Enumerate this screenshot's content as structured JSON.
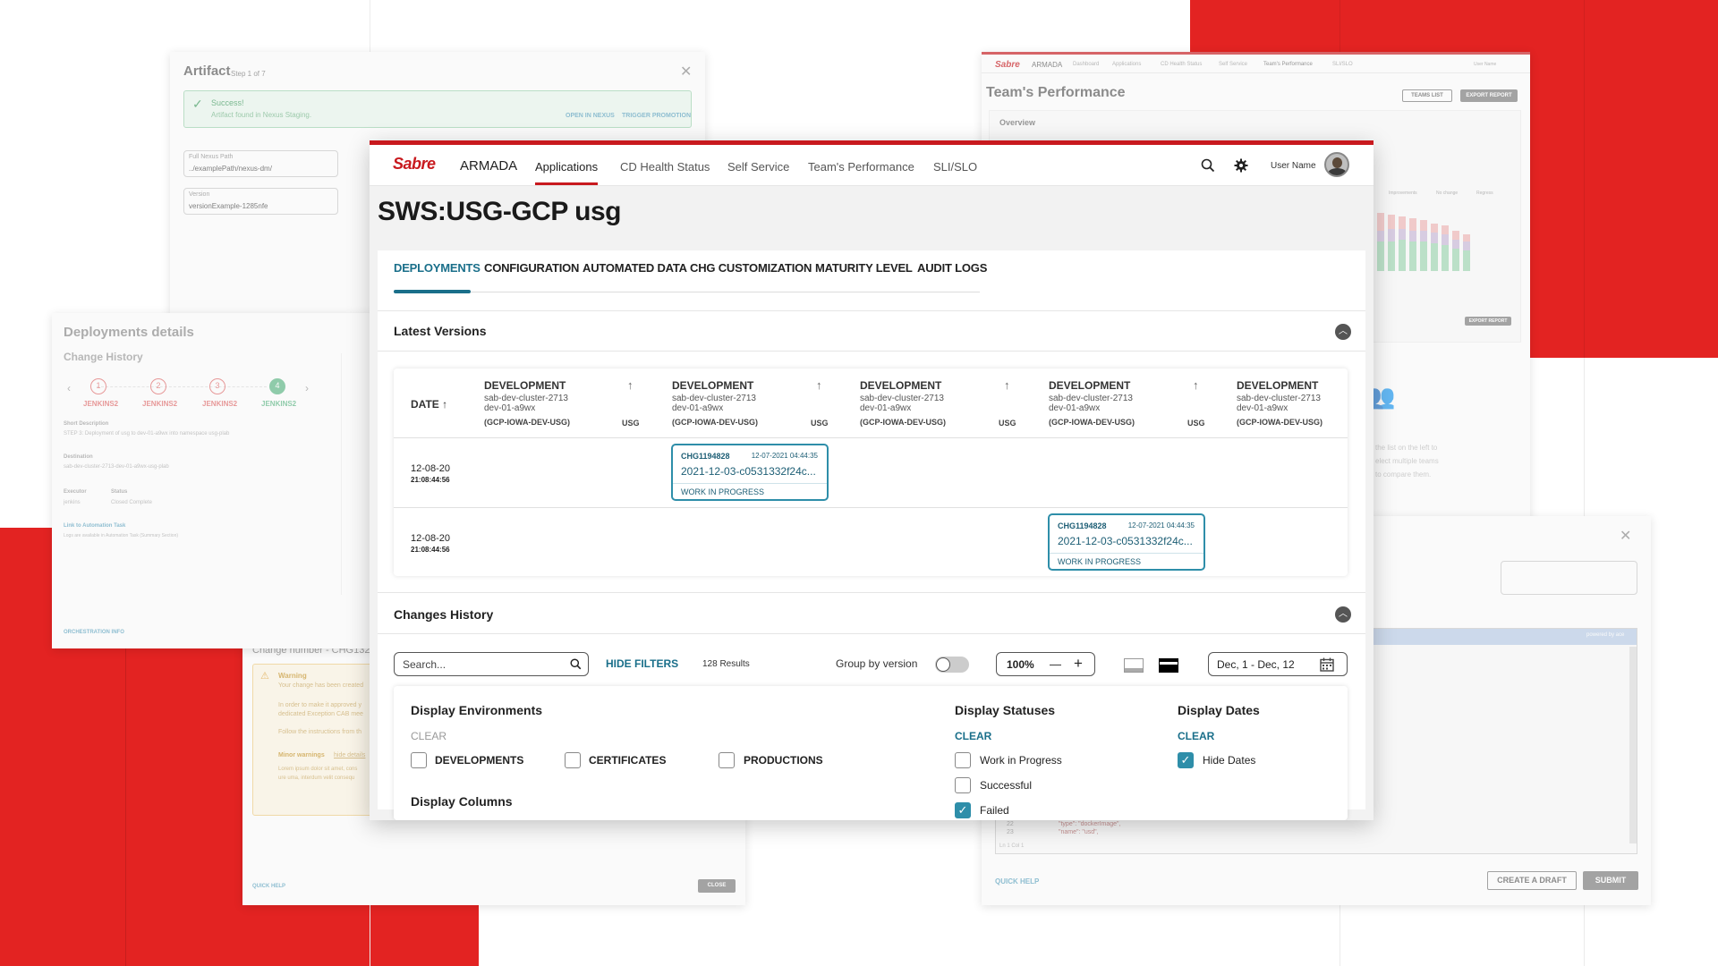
{
  "colors": {
    "brand_red": "#e32322",
    "accent_teal": "#1a6f8a",
    "chg_border": "#2e8ea9"
  },
  "ghost_artifact": {
    "title": "Artifact",
    "step": "Step 1 of 7",
    "success_title": "Success!",
    "success_text": "Artifact found in Nexus Staging.",
    "open_link": "OPEN IN NEXUS",
    "trigger_link": "TRIGGER PROMOTION",
    "path_label": "Full Nexus Path",
    "path_value": "../examplePath/nexus-dm/",
    "version_label": "Version",
    "version_value": "versionExample-1285nfe"
  },
  "ghost_deployments": {
    "title": "Deployments details",
    "subtitle": "Change History",
    "steps": [
      {
        "n": "1",
        "label": "JENKINS2"
      },
      {
        "n": "2",
        "label": "JENKINS2"
      },
      {
        "n": "3",
        "label": "JENKINS2"
      },
      {
        "n": "4",
        "label": "JENKINS2"
      }
    ],
    "short_desc_label": "Short Description",
    "short_desc": "STEP 3: Deployment of usg to dev-01-a9wx into namespace usg-plab",
    "dest_label": "Destination",
    "dest": "sab-dev-cluster-2713-dev-01-a9wx-usg-plab",
    "executor_label": "Executor",
    "executor": "jenkins",
    "status_label": "Status",
    "status": "Closed Complete",
    "link": "Link to Automation Task",
    "link_note": "Logs are available in Automation Task (Summary Section)",
    "orch": "ORCHESTRATION INFO"
  },
  "ghost_change": {
    "change_number": "Change number - CHG132",
    "warning": "Warning",
    "w1": "Your change has been created",
    "w2": "In order to make it approved y",
    "w3": "dedicated Exception CAB mee",
    "w4": "Follow the instructions from th",
    "minor": "Minor warnings",
    "hide": "hide details",
    "lorem1": "Lorem ipsum dolor sit amet, cons",
    "lorem2": "ure uma, interdum velit consequ",
    "quick_help": "QUICK HELP",
    "close": "CLOSE"
  },
  "ghost_perf": {
    "brand": "Sabre",
    "app": "ARMADA",
    "nav": [
      "Dashboard",
      "Applications",
      "CD Health Status",
      "Self Service",
      "Team's Performance",
      "SLI/SLO"
    ],
    "user": "User Name",
    "title": "Team's Performance",
    "teams_list": "TEAMS LIST",
    "export": "EXPORT REPORT",
    "overview": "Overview",
    "legend": [
      "Improvements",
      "No change",
      "Regress"
    ],
    "export2": "EXPORT REPORT",
    "hint1": "the list on the left to",
    "hint2": "elect multiple teams",
    "hint3": "to compare them."
  },
  "ghost_submit": {
    "powered": "powered by ace",
    "code1": "\"type\": \"dockerImage\",",
    "code2": "\"name\": \"usd\",",
    "ln": "Ln 1 Col 1",
    "quick_help": "QUICK HELP",
    "draft": "CREATE A DRAFT",
    "submit": "SUBMIT"
  },
  "header": {
    "brand": "Sabre",
    "app_name": "ARMADA",
    "nav": [
      "Applications",
      "CD Health Status",
      "Self Service",
      "Team's Performance",
      "SLI/SLO"
    ],
    "user_name": "User Name"
  },
  "page_title": "SWS:USG-GCP usg",
  "tabs": [
    "DEPLOYMENTS",
    "CONFIGURATION",
    "AUTOMATED DATA",
    "CHG CUSTOMIZATION",
    "MATURITY LEVEL",
    "AUDIT LOGS"
  ],
  "latest": {
    "title": "Latest Versions",
    "date_header": "DATE",
    "columns": [
      {
        "env": "DEVELOPMENT",
        "cluster": "sab-dev-cluster-2713",
        "ns": "dev-01-a9wx",
        "region": "(GCP-IOWA-DEV-USG)",
        "app": "USG"
      },
      {
        "env": "DEVELOPMENT",
        "cluster": "sab-dev-cluster-2713",
        "ns": "dev-01-a9wx",
        "region": "(GCP-IOWA-DEV-USG)",
        "app": "USG"
      },
      {
        "env": "DEVELOPMENT",
        "cluster": "sab-dev-cluster-2713",
        "ns": "dev-01-a9wx",
        "region": "(GCP-IOWA-DEV-USG)",
        "app": "USG"
      },
      {
        "env": "DEVELOPMENT",
        "cluster": "sab-dev-cluster-2713",
        "ns": "dev-01-a9wx",
        "region": "(GCP-IOWA-DEV-USG)",
        "app": "USG"
      },
      {
        "env": "DEVELOPMENT",
        "cluster": "sab-dev-cluster-2713",
        "ns": "dev-01-a9wx",
        "region": "(GCP-IOWA-DEV-USG)"
      }
    ],
    "rows": [
      {
        "date": "12-08-20",
        "time": "21:08:44:56",
        "card": {
          "id": "CHG1194828",
          "ts": "12-07-2021 04:44:35",
          "version": "2021-12-03-c0531332f24c...",
          "status": "WORK IN PROGRESS"
        }
      },
      {
        "date": "12-08-20",
        "time": "21:08:44:56",
        "card": {
          "id": "CHG1194828",
          "ts": "12-07-2021 04:44:35",
          "version": "2021-12-03-c0531332f24c...",
          "status": "WORK IN PROGRESS"
        }
      }
    ]
  },
  "history": {
    "title": "Changes History",
    "search_placeholder": "Search...",
    "hide_filters": "HIDE FILTERS",
    "results": "128 Results",
    "group_by": "Group by version",
    "zoom": "100%",
    "minus": "—",
    "plus": "+",
    "date_range": "Dec, 1 - Dec, 12"
  },
  "filters": {
    "env_title": "Display Environments",
    "env_clear": "CLEAR",
    "envs": [
      "DEVELOPMENTS",
      "CERTIFICATES",
      "PRODUCTIONS"
    ],
    "cols_title": "Display Columns",
    "status_title": "Display Statuses",
    "status_clear": "CLEAR",
    "statuses": [
      "Work in Progress",
      "Successful",
      "Failed"
    ],
    "dates_title": "Display Dates",
    "dates_clear": "CLEAR",
    "dates_option": "Hide Dates",
    "check": "✓"
  }
}
